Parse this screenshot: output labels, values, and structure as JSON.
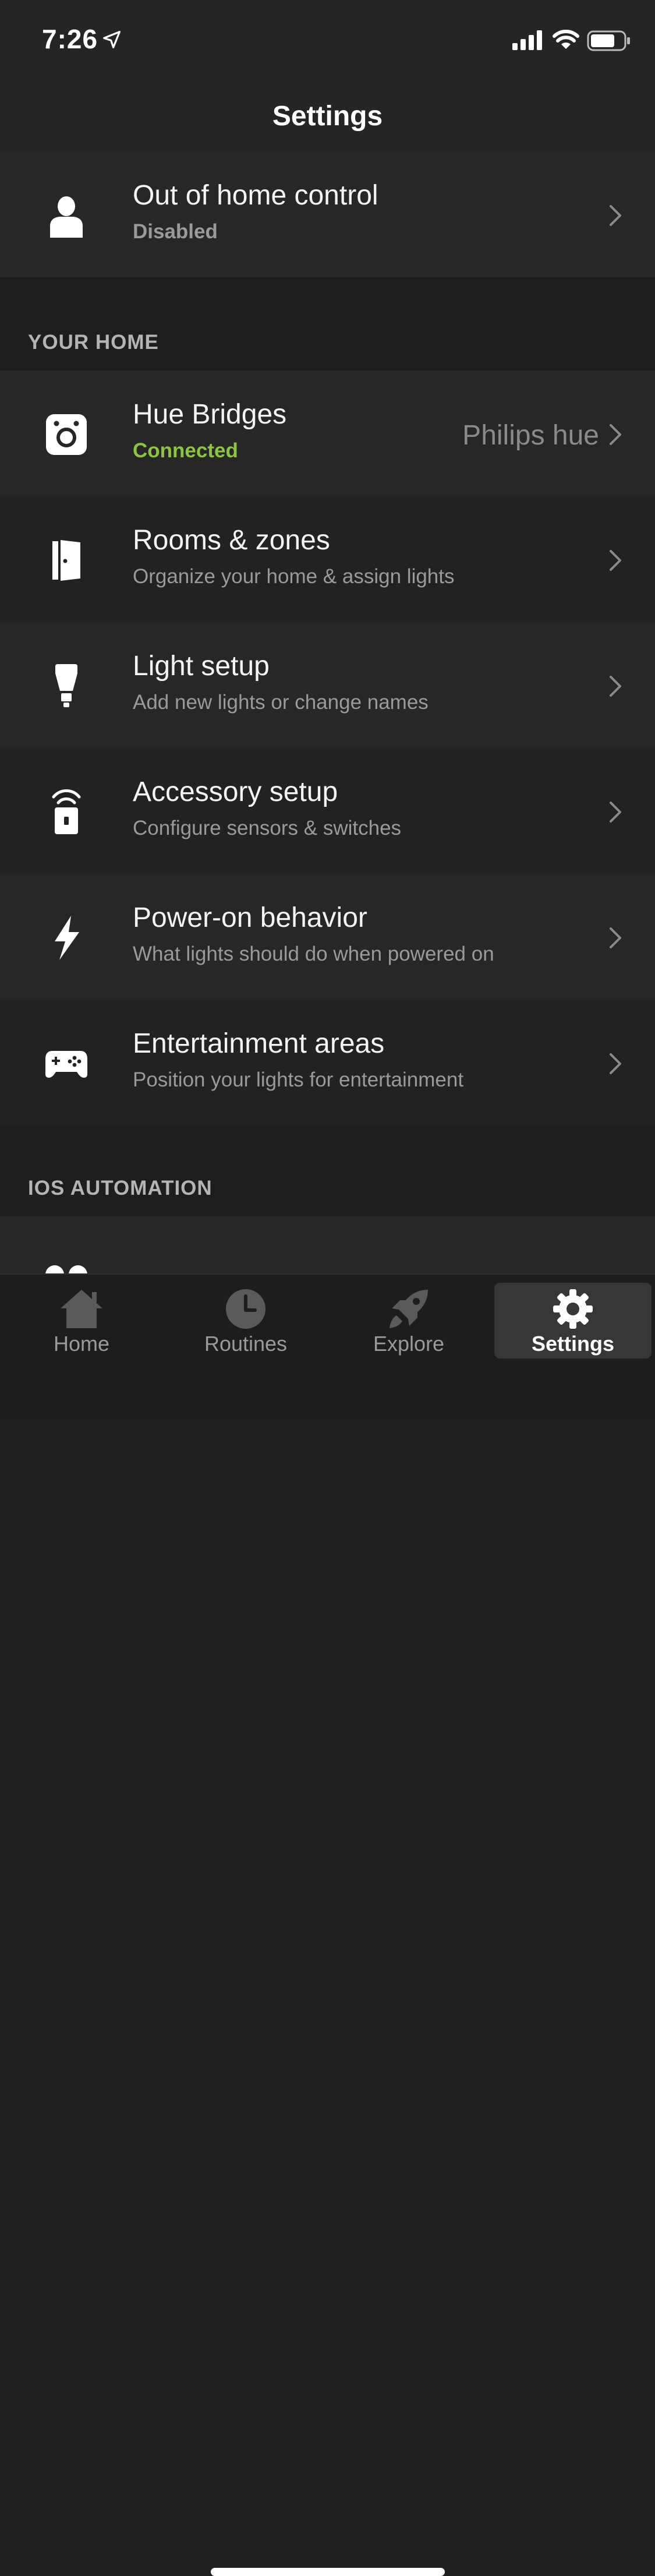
{
  "status_bar": {
    "time": "7:26"
  },
  "nav": {
    "title": "Settings"
  },
  "out_of_home": {
    "title": "Out of home control",
    "subtitle": "Disabled"
  },
  "sections": {
    "your_home": "YOUR HOME",
    "ios_automation": "IOS AUTOMATION"
  },
  "your_home_items": [
    {
      "title": "Hue Bridges",
      "subtitle": "Connected",
      "value": "Philips hue",
      "icon": "bridge-icon"
    },
    {
      "title": "Rooms & zones",
      "subtitle": "Organize your home & assign lights",
      "icon": "door-icon"
    },
    {
      "title": "Light setup",
      "subtitle": "Add new lights or change names",
      "icon": "bulb-icon"
    },
    {
      "title": "Accessory setup",
      "subtitle": "Configure sensors & switches",
      "icon": "accessory-icon"
    },
    {
      "title": "Power-on behavior",
      "subtitle": "What lights should do when powered on",
      "icon": "lightning-icon"
    },
    {
      "title": "Entertainment areas",
      "subtitle": "Position your lights for entertainment",
      "icon": "gamepad-icon"
    }
  ],
  "tabs": [
    {
      "label": "Home",
      "icon": "house-icon"
    },
    {
      "label": "Routines",
      "icon": "clock-icon"
    },
    {
      "label": "Explore",
      "icon": "rocket-icon"
    },
    {
      "label": "Settings",
      "icon": "gear-icon",
      "active": true
    }
  ],
  "colors": {
    "connected": "#8cc63f",
    "background": "#202020",
    "row_alt": "#272727"
  }
}
